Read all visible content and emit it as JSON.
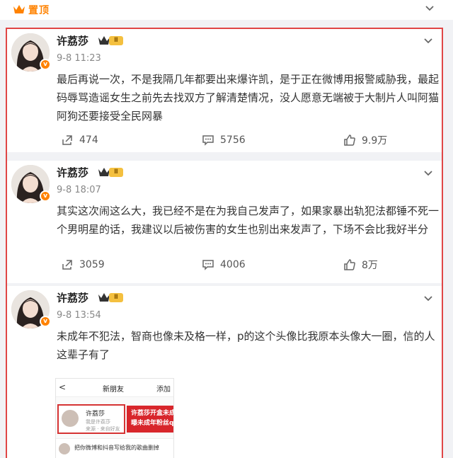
{
  "pin": {
    "label": "置顶",
    "icon": "crown-icon"
  },
  "colors": {
    "accent": "#ff8200",
    "highlight": "#e04646",
    "badge": "#f4c03f"
  },
  "posts": [
    {
      "author": "许荔莎",
      "level": "Ⅱ",
      "verified": "v",
      "time": "9-8 11:23",
      "text": "最后再说一次，不是我隔几年都要出来爆许凯，是于正在微博用报警威胁我，最起码辱骂造谣女生之前先去找双方了解清楚情况，没人愿意无端被于大制片人叫阿猫阿狗还要接受全民网暴",
      "reposts": "474",
      "comments": "5756",
      "likes": "9.9万"
    },
    {
      "author": "许荔莎",
      "level": "Ⅱ",
      "verified": "v",
      "time": "9-8 18:07",
      "text": "其实这次闹这么大，我已经不是在为我自己发声了，如果家暴出轨犯法都锤不死一个男明星的话，我建议以后被伤害的女生也别出来发声了，下场不会比我好半分",
      "reposts": "3059",
      "comments": "4006",
      "likes": "8万"
    },
    {
      "author": "许荔莎",
      "level": "Ⅱ",
      "verified": "v",
      "time": "9-8 13:54",
      "text": "未成年不犯法，智商也像未及格一样，p的这个头像比我原本头像大一圈，信的人这辈子有了",
      "embed": {
        "back": "<",
        "title": "新朋友",
        "add": "添加",
        "friend_name": "许荔莎",
        "friend_sub": "我是许荔莎",
        "friend_sub2": "来源 · 来自好友",
        "banner_line1": "许荔莎开盒未成",
        "banner_line2": "曝未成年粉丝qq",
        "message": "把你微博和抖音写给我的歌曲删掉"
      }
    }
  ]
}
